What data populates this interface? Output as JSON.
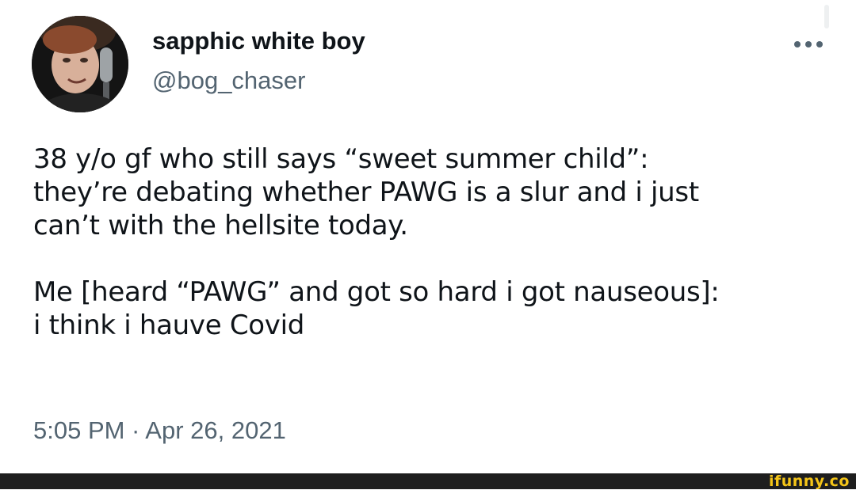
{
  "author": {
    "display_name": "sapphic white boy",
    "handle": "@bog_chaser",
    "avatar_icon": "profile-photo"
  },
  "tweet": {
    "paragraphs": [
      {
        "lines": [
          "38 y/o gf who still says “sweet summer child”:",
          "they’re debating whether PAWG is a slur and i just",
          "can’t with the hellsite today."
        ]
      },
      {
        "lines": [
          "Me [heard “PAWG” and got so hard i got nauseous]:",
          "i think i hauve Covid"
        ]
      }
    ],
    "timestamp": "5:05 PM · Apr 26, 2021"
  },
  "menu": {
    "more_icon": "more-horizontal-icon"
  },
  "watermark": {
    "text": "ifunny.co"
  },
  "colors": {
    "text_primary": "#0f1419",
    "text_secondary": "#536471",
    "bar": "#1e1e1e",
    "watermark": "#f5c518"
  }
}
